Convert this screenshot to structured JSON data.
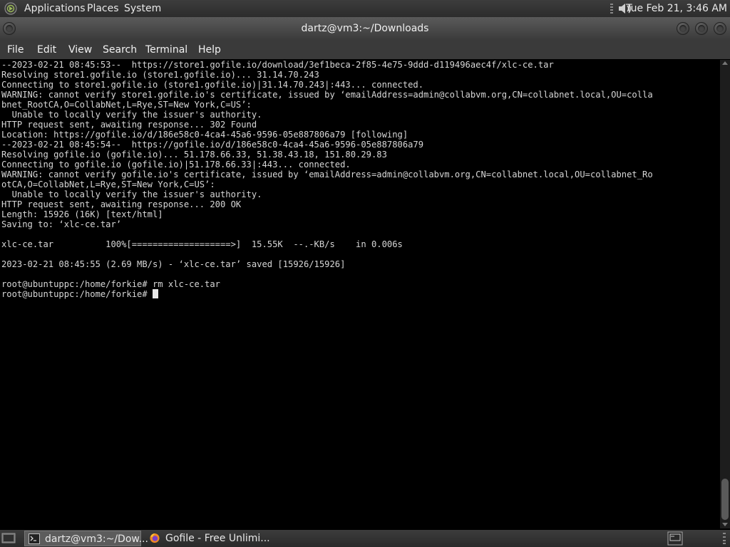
{
  "top_panel": {
    "menus": [
      "Applications",
      "Places",
      "System"
    ],
    "clock": "Tue Feb 21,  3:46 AM",
    "icons": [
      "apps-logo-icon",
      "volume-icon"
    ]
  },
  "window": {
    "title": "dartz@vm3:~/Downloads",
    "buttons": [
      "minimize-button",
      "maximize-button",
      "close-button"
    ]
  },
  "menubar": [
    "File",
    "Edit",
    "View",
    "Search",
    "Terminal",
    "Help"
  ],
  "terminal": {
    "lines": [
      "--2023-02-21 08:45:53--  https://store1.gofile.io/download/3ef1beca-2f85-4e75-9ddd-d119496aec4f/xlc-ce.tar",
      "Resolving store1.gofile.io (store1.gofile.io)... 31.14.70.243",
      "Connecting to store1.gofile.io (store1.gofile.io)|31.14.70.243|:443... connected.",
      "WARNING: cannot verify store1.gofile.io's certificate, issued by ‘emailAddress=admin@collabvm.org,CN=collabnet.local,OU=colla",
      "bnet_RootCA,O=CollabNet,L=Rye,ST=New York,C=US’:",
      "  Unable to locally verify the issuer's authority.",
      "HTTP request sent, awaiting response... 302 Found",
      "Location: https://gofile.io/d/186e58c0-4ca4-45a6-9596-05e887806a79 [following]",
      "--2023-02-21 08:45:54--  https://gofile.io/d/186e58c0-4ca4-45a6-9596-05e887806a79",
      "Resolving gofile.io (gofile.io)... 51.178.66.33, 51.38.43.18, 151.80.29.83",
      "Connecting to gofile.io (gofile.io)|51.178.66.33|:443... connected.",
      "WARNING: cannot verify gofile.io's certificate, issued by ‘emailAddress=admin@collabvm.org,CN=collabnet.local,OU=collabnet_Ro",
      "otCA,O=CollabNet,L=Rye,ST=New York,C=US’:",
      "  Unable to locally verify the issuer's authority.",
      "HTTP request sent, awaiting response... 200 OK",
      "Length: 15926 (16K) [text/html]",
      "Saving to: ‘xlc-ce.tar’",
      "",
      "xlc-ce.tar          100%[===================>]  15.55K  --.-KB/s    in 0.006s",
      "",
      "2023-02-21 08:45:55 (2.69 MB/s) - ‘xlc-ce.tar’ saved [15926/15926]",
      "",
      "root@ubuntuppc:/home/forkie# rm xlc-ce.tar",
      "root@ubuntuppc:/home/forkie# "
    ]
  },
  "taskbar": {
    "tasks": [
      {
        "label": "dartz@vm3:~/Dow...",
        "icon": "terminal-icon",
        "active": true
      },
      {
        "label": "Gofile - Free Unlimi...",
        "icon": "firefox-icon",
        "active": false
      }
    ]
  },
  "colors": {
    "terminal_bg": "#000000",
    "terminal_fg": "#d6d6d6",
    "panel_bg": "#3a3a3a"
  }
}
